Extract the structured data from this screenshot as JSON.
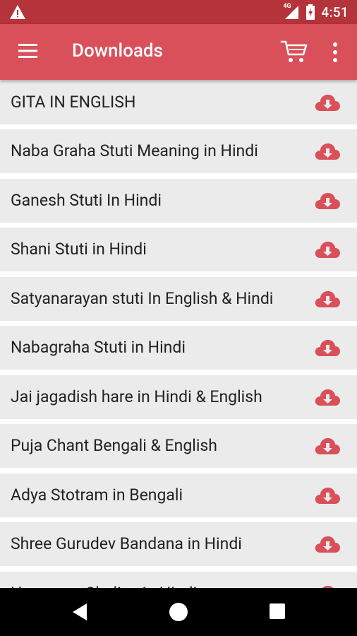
{
  "status_bar": {
    "time": "4:51",
    "network": "4G",
    "icons": [
      "warning-icon",
      "signal-icon",
      "battery-charging-icon"
    ]
  },
  "app_bar": {
    "title": "Downloads",
    "icons": [
      "menu-icon",
      "cart-icon",
      "more-vert-icon"
    ]
  },
  "colors": {
    "app_bar": "#d9505a",
    "status_bar": "#b5333a",
    "row_bg": "#ebebeb",
    "icon": "#d9505a",
    "nav_bar": "#000000"
  },
  "downloads": [
    {
      "label": "GITA IN ENGLISH",
      "icon": "cloud-download-icon"
    },
    {
      "label": "Naba Graha Stuti Meaning in Hindi",
      "icon": "cloud-download-icon"
    },
    {
      "label": "Ganesh Stuti In Hindi",
      "icon": "cloud-download-icon"
    },
    {
      "label": "Shani Stuti in Hindi",
      "icon": "cloud-download-icon"
    },
    {
      "label": "Satyanarayan stuti In English & Hindi",
      "icon": "cloud-download-icon"
    },
    {
      "label": "Nabagraha Stuti in Hindi",
      "icon": "cloud-download-icon"
    },
    {
      "label": "Jai jagadish hare in Hindi & English",
      "icon": "cloud-download-icon"
    },
    {
      "label": "Puja Chant Bengali & English",
      "icon": "cloud-download-icon"
    },
    {
      "label": "Adya Stotram in Bengali",
      "icon": "cloud-download-icon"
    },
    {
      "label": "Shree Gurudev Bandana in Hindi",
      "icon": "cloud-download-icon"
    },
    {
      "label": "Hanuman Chalisa in Hindi",
      "icon": "cloud-download-icon"
    }
  ],
  "nav_bar": {
    "icons": [
      "back-icon",
      "home-icon",
      "recents-icon"
    ]
  }
}
